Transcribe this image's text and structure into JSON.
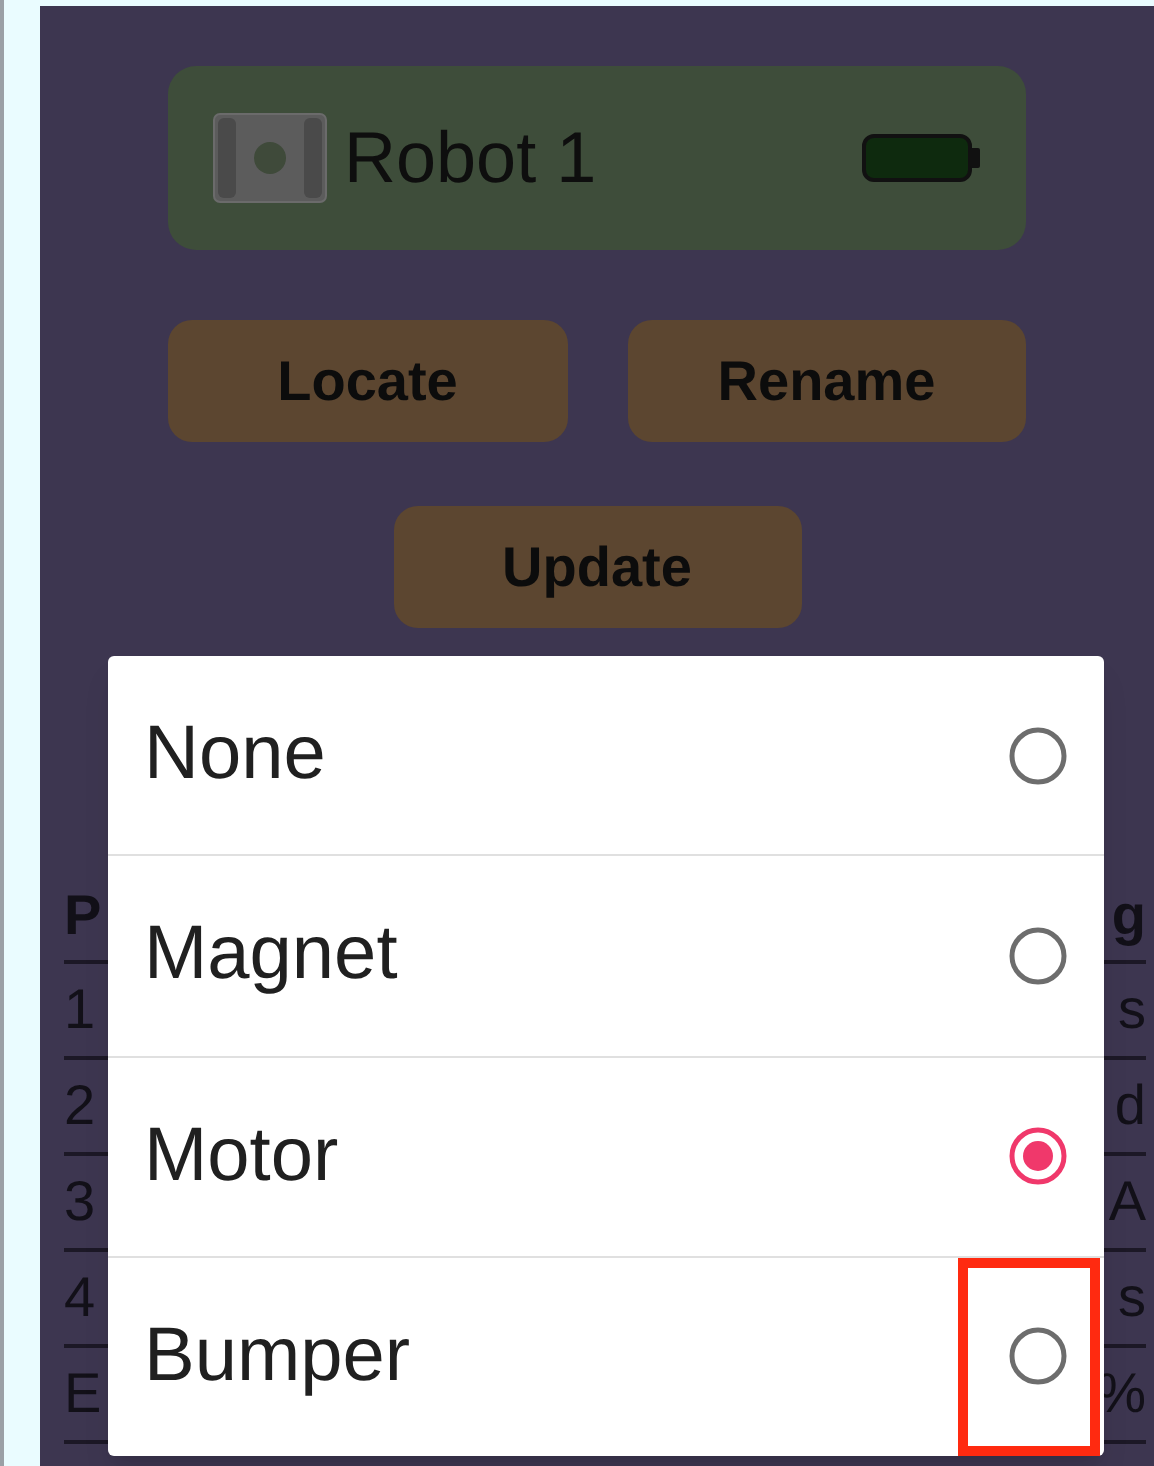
{
  "robot_card": {
    "name": "Robot 1"
  },
  "buttons": [
    "Locate",
    "Rename",
    "Update"
  ],
  "table": {
    "columns": [
      "P",
      "g"
    ],
    "rows": [
      {
        "column_1": "1",
        "column_2": "s"
      },
      {
        "column_1": "2",
        "column_2": "d"
      },
      {
        "column_1": "3",
        "column_2": "A"
      },
      {
        "column_1": "4",
        "column_2": "s"
      },
      {
        "column_1": "E",
        "column_2": "%"
      }
    ]
  },
  "dialog": {
    "options": [
      {
        "label": "None",
        "selected": false,
        "highlighted": false
      },
      {
        "label": "Magnet",
        "selected": false,
        "highlighted": false
      },
      {
        "label": "Motor",
        "selected": true,
        "highlighted": false
      },
      {
        "label": "Bumper",
        "selected": false,
        "highlighted": true
      }
    ]
  }
}
